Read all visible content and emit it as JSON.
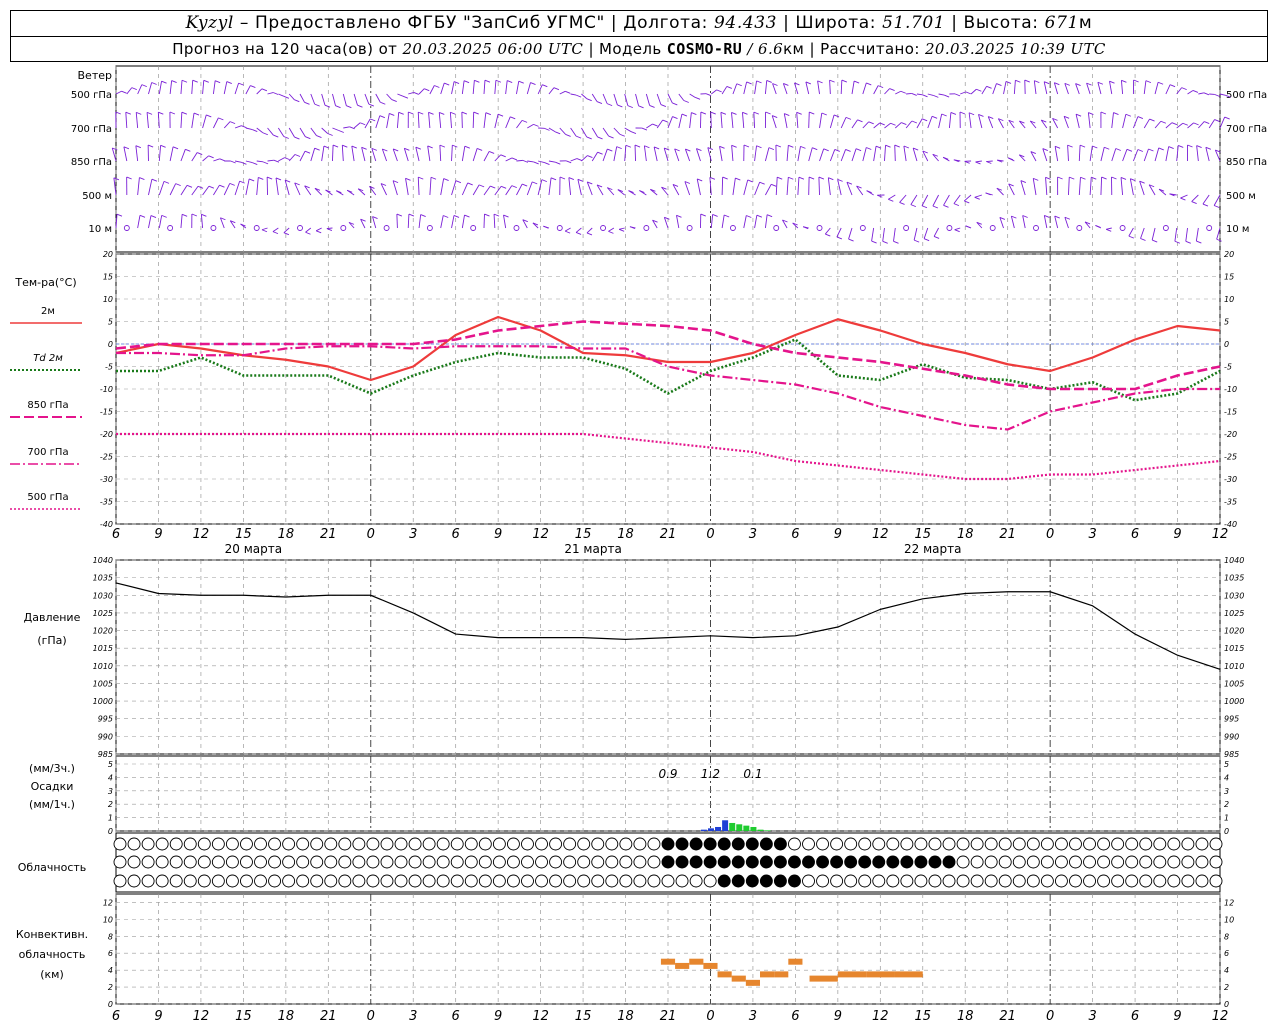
{
  "header": {
    "station": "Kyzyl",
    "provided_by": "– Предоставлено ФГБУ \"ЗапСиб УГМС\" |",
    "lon_label": "Долгота:",
    "lon": "94.433",
    "lat_label": "| Широта:",
    "lat": "51.701",
    "alt_label": "| Высота:",
    "alt": "671",
    "alt_unit": "м",
    "fc_label": "Прогноз на 120 часа(ов) от",
    "fc_time": "20.03.2025 06:00 UTC",
    "model_label": "| Модель",
    "model": "COSMO-RU",
    "model_res": "/ 6.6",
    "model_res_unit": "км",
    "calc_label": "| Рассчитано:",
    "calc_time": "20.03.2025 10:39 UTC"
  },
  "labels": {
    "wind": "Ветер",
    "wind_levels": [
      "500 гПа",
      "700 гПа",
      "850 гПа",
      "500 м",
      "10 м"
    ],
    "temp_title": "Тем-ра(°C)",
    "legend": [
      "2м",
      "Td  2м",
      "850 гПа",
      "700 гПа",
      "500 гПа"
    ],
    "pressure": "Давление",
    "pressure_unit": "(гПа)",
    "precip_top": "(мм/3ч.)",
    "precip_mid": "Осадки",
    "precip_bot": "(мм/1ч.)",
    "cloud": "Облачность",
    "conv1": "Конвективн.",
    "conv2": "облачность",
    "conv3": "(км)",
    "dates": [
      "20 марта",
      "21 марта",
      "22 марта"
    ]
  },
  "colors": {
    "t2m": "#ee3b3b",
    "td2m": "#1a7a1a",
    "t850": "#e4148c",
    "t700": "#e4148c",
    "t500": "#e4148c",
    "wind": "#7a1fd6",
    "pressure": "#000000",
    "conv": "#e6862e",
    "grid": "#9a9a9a",
    "zero_line": "#4b6be0"
  },
  "chart_data": [
    {
      "type": "line",
      "name": "wind",
      "x_hours_from_start": "0..102 step 1",
      "note_levels": [
        "500 гПа",
        "700 гПа",
        "850 гПа",
        "500 м",
        "10 м"
      ]
    },
    {
      "type": "line",
      "title": "Тем-ра(°C)",
      "x_ticks": [
        "6",
        "9",
        "12",
        "15",
        "18",
        "21",
        "0",
        "3",
        "6",
        "9",
        "12",
        "15",
        "18",
        "21",
        "0",
        "3",
        "6",
        "9",
        "12",
        "15",
        "18",
        "21",
        "0",
        "3",
        "6",
        "9",
        "12"
      ],
      "ylim": [
        -40,
        20
      ],
      "y_ticks": [
        20,
        15,
        10,
        5,
        0,
        -5,
        -10,
        -15,
        -20,
        -25,
        -30,
        -35,
        -40
      ],
      "x": [
        0,
        3,
        6,
        9,
        12,
        15,
        18,
        21,
        24,
        27,
        30,
        33,
        36,
        39,
        42,
        45,
        48,
        51,
        54,
        57,
        60,
        63,
        66,
        69,
        72,
        75,
        78
      ],
      "series": [
        {
          "name": "2м",
          "values": [
            -2,
            0,
            -1,
            -2.5,
            -3.5,
            -5,
            -8,
            -5,
            2,
            6,
            3,
            -2,
            -2.5,
            -4,
            -4,
            -2,
            2,
            5.5,
            3,
            0,
            -2,
            -4.5,
            -6,
            -3,
            1,
            4,
            3
          ]
        },
        {
          "name": "Td  2м",
          "values": [
            -6,
            -6,
            -3,
            -7,
            -7,
            -7,
            -11,
            -7,
            -4,
            -2,
            -3,
            -3,
            -5.5,
            -11,
            -6,
            -3,
            1,
            -7,
            -8,
            -4.5,
            -7.5,
            -8,
            -10,
            -8.5,
            -12.5,
            -11,
            -6
          ]
        },
        {
          "name": "850 гПа",
          "values": [
            -1,
            0,
            0,
            0,
            0,
            0,
            0,
            0,
            1,
            3,
            4,
            5,
            4.5,
            4,
            3,
            0,
            -2,
            -3,
            -4,
            -5.5,
            -7,
            -9,
            -10,
            -10,
            -10,
            -7,
            -5
          ]
        },
        {
          "name": "700 гПа",
          "values": [
            -2,
            -2,
            -2.5,
            -2.5,
            -1,
            -0.5,
            -0.5,
            -1,
            -0.5,
            -0.5,
            -0.5,
            -1,
            -1,
            -5,
            -7,
            -8,
            -9,
            -11,
            -14,
            -16,
            -18,
            -19,
            -15,
            -13,
            -11,
            -10,
            -10
          ]
        },
        {
          "name": "500 гПа",
          "values": [
            -20,
            -20,
            -20,
            -20,
            -20,
            -20,
            -20,
            -20,
            -20,
            -20,
            -20,
            -20,
            -21,
            -22,
            -23,
            -24,
            -26,
            -27,
            -28,
            -29,
            -30,
            -30,
            -29,
            -29,
            -28,
            -27,
            -26
          ]
        }
      ]
    },
    {
      "type": "line",
      "title": "Давление",
      "ylabel": "(гПа)",
      "ylim": [
        985,
        1040
      ],
      "y_ticks": [
        1040,
        1035,
        1030,
        1025,
        1020,
        1015,
        1010,
        1005,
        1000,
        995,
        990,
        985
      ],
      "x": [
        0,
        3,
        6,
        9,
        12,
        15,
        18,
        21,
        24,
        27,
        30,
        33,
        36,
        39,
        42,
        45,
        48,
        51,
        54,
        57,
        60,
        63,
        66,
        69,
        72,
        75,
        78
      ],
      "series": [
        {
          "name": "Давление",
          "values": [
            1033.5,
            1030.5,
            1030,
            1030,
            1029.5,
            1030,
            1030,
            1025,
            1019,
            1018,
            1018,
            1018,
            1017.5,
            1018,
            1018.5,
            1018,
            1018.5,
            1021,
            1026,
            1029,
            1030.5,
            1031,
            1031,
            1027,
            1019,
            1013,
            1009
          ]
        }
      ]
    },
    {
      "type": "bar",
      "title": "Осадки",
      "ylim": [
        0,
        5
      ],
      "y_ticks": [
        5,
        4,
        3,
        2,
        1,
        0
      ],
      "annotations": [
        "0.9",
        "1.2",
        "0.1"
      ],
      "x": [
        41.5,
        42,
        42.5,
        43,
        43.5,
        44,
        44.5,
        45,
        45.5,
        46
      ],
      "values": [
        0.1,
        0.2,
        0.3,
        0.8,
        0.6,
        0.5,
        0.4,
        0.3,
        0.1,
        0.05
      ]
    },
    {
      "type": "bar",
      "title": "Конвективн. облачность (км)",
      "ylim": [
        0,
        13
      ],
      "y_ticks": [
        12,
        10,
        8,
        6,
        4,
        2,
        0
      ],
      "x": [
        39,
        40,
        41,
        42,
        43,
        44,
        45,
        46,
        47,
        48,
        50,
        52,
        54,
        56
      ],
      "values": [
        5,
        4.5,
        5,
        4.5,
        3.5,
        3,
        2.5,
        3.5,
        3.5,
        5,
        3,
        3.5,
        3.5,
        3.5
      ]
    }
  ]
}
